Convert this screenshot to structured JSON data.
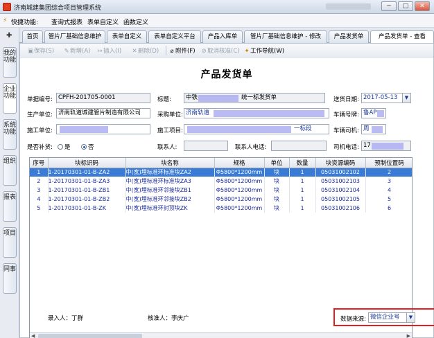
{
  "window": {
    "title": "济南城建集团综合项目管理系统",
    "min": "─",
    "max": "□",
    "close": "✕"
  },
  "menubar": {
    "items": [
      "快捷功能:",
      "查询式报表",
      "表单自定义",
      "函数定义"
    ]
  },
  "leftbar": {
    "items": [
      "我的功能",
      "企业功能",
      "系统功能",
      "组织",
      "报表",
      "项目",
      "同事"
    ]
  },
  "tabs": [
    "首页",
    "管片厂基础信息维护",
    "表单自定义",
    "表单自定义平台",
    "产品入库单",
    "管片厂基础信息维护 - 修改",
    "产品发货单",
    "产品发货单 - 查看"
  ],
  "toolbar": {
    "save": "保存(S)",
    "add": "新增(A)",
    "insert": "插入(I)",
    "delete": "删除(D)",
    "attach": "附件(F)",
    "cancel_audit": "取消核准(C)",
    "workflow": "工作导航(W)"
  },
  "form": {
    "title": "产品发货单",
    "doc_no_label": "单据编号:",
    "doc_no": "CPFH-201705-0001",
    "subject_label": "标题:",
    "subject_a": "中铁",
    "subject_b": "统一标发货单",
    "ship_date_label": "送货日期:",
    "ship_date": "2017-05-13",
    "producer_label": "生产单位:",
    "producer": "济南轨道城建管片制造有限公司",
    "buyer_label": "采购单位:",
    "buyer": "济南轨道",
    "plate_label": "车辆号牌:",
    "plate": "鲁AP",
    "builder_label": "施工单位:",
    "project_label": "施工项目:",
    "project_tail": "一标段",
    "driver_label": "车辆司机:",
    "driver": "周",
    "supplement_label": "是否补货:",
    "yes": "是",
    "no": "否",
    "contact_label": "联系人:",
    "contact_phone_label": "联系人电话:",
    "driver_phone_label": "司机电话:",
    "driver_phone": "17"
  },
  "grid": {
    "columns": [
      "序号",
      "块标识码",
      "块名称",
      "规格",
      "单位",
      "数量",
      "块资源编码",
      "预制位置码"
    ],
    "rows": [
      [
        "1",
        "1-20170301-01-B-ZA2",
        "中(宽)埋标准环标准块ZA2",
        "Φ5800*1200mm",
        "块",
        "1",
        "05031002102",
        "2"
      ],
      [
        "2",
        "1-20170301-01-B-ZA3",
        "中(宽)埋标准环标准块ZA3",
        "Φ5800*1200mm",
        "块",
        "1",
        "05031002103",
        "3"
      ],
      [
        "3",
        "1-20170301-01-B-ZB1",
        "中(宽)埋标准环邻接块ZB1",
        "Φ5800*1200mm",
        "块",
        "1",
        "05031002104",
        "4"
      ],
      [
        "4",
        "1-20170301-01-B-ZB2",
        "中(宽)埋标准环邻接块ZB2",
        "Φ5800*1200mm",
        "块",
        "1",
        "05031002105",
        "5"
      ],
      [
        "5",
        "1-20170301-01-B-ZK",
        "中(宽)埋标准环封顶块ZK",
        "Φ5800*1200mm",
        "块",
        "1",
        "05031002106",
        "6"
      ]
    ]
  },
  "footer": {
    "entered_by": "录入人：丁群",
    "approved_by": "核准人：李庆广",
    "source_label": "数据来源:",
    "source_value": "微信企业号"
  },
  "colors": {
    "accent": "#3a7bd5",
    "highlight": "#e02020"
  }
}
